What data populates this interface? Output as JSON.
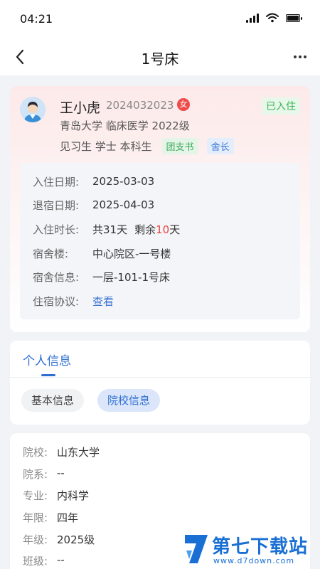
{
  "status_bar": {
    "time": "04:21"
  },
  "nav": {
    "title": "1号床"
  },
  "profile": {
    "name": "王小虎",
    "student_id": "2024032023",
    "gender": "女",
    "status": "已入住",
    "school_line": "青岛大学 临床医学 2022级",
    "role_text": "见习生 学士 本科生",
    "tag_league": "团支书",
    "tag_dorm": "舍长"
  },
  "stay": {
    "checkin_label": "入住日期:",
    "checkin_value": "2025-03-03",
    "checkout_label": "退宿日期:",
    "checkout_value": "2025-04-03",
    "duration_label": "入住时长:",
    "duration_total": "共31天",
    "duration_remaining_prefix": "剩余",
    "duration_remaining_days": "10",
    "duration_remaining_suffix": "天",
    "building_label": "宿舍楼:",
    "building_value": "中心院区-一号楼",
    "room_label": "宿舍信息:",
    "room_value": "一层-101-1号床",
    "agreement_label": "住宿协议:",
    "agreement_link": "查看"
  },
  "tabs": {
    "personal_label": "个人信息",
    "chip_basic": "基本信息",
    "chip_school": "院校信息"
  },
  "school_info": {
    "rows": [
      {
        "label": "院校:",
        "value": "山东大学"
      },
      {
        "label": "院系:",
        "value": "--"
      },
      {
        "label": "专业:",
        "value": "内科学"
      },
      {
        "label": "年限:",
        "value": "四年"
      },
      {
        "label": "年级:",
        "value": "2025级"
      },
      {
        "label": "班级:",
        "value": "--"
      }
    ]
  },
  "watermark": {
    "cn": "第七下载站",
    "en": "www.d7down.com"
  },
  "colors": {
    "accent_blue": "#2f6fd1",
    "accent_red": "#e8453c",
    "status_green": "#3fb55a"
  }
}
